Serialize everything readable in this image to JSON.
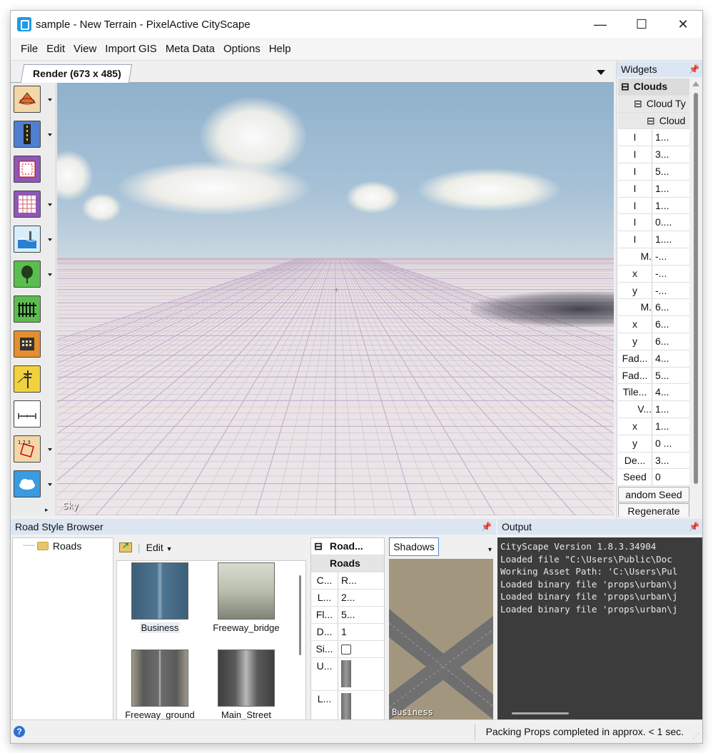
{
  "window": {
    "title": "sample - New Terrain - PixelActive CityScape",
    "minimize": "—",
    "maximize": "☐",
    "close": "✕"
  },
  "menu": [
    "File",
    "Edit",
    "View",
    "Import GIS",
    "Meta Data",
    "Options",
    "Help"
  ],
  "render_tab": {
    "label": "Render (673 x 485)"
  },
  "render": {
    "overlay_label": "Sky"
  },
  "toolbar_tools": [
    {
      "name": "terrain-tool-icon",
      "has_dropdown": true
    },
    {
      "name": "road-tool-icon",
      "has_dropdown": true
    },
    {
      "name": "lot-tool-icon",
      "has_dropdown": false
    },
    {
      "name": "grid-tool-icon",
      "has_dropdown": true
    },
    {
      "name": "water-tool-icon",
      "has_dropdown": true
    },
    {
      "name": "tree-tool-icon",
      "has_dropdown": true
    },
    {
      "name": "fence-tool-icon",
      "has_dropdown": false
    },
    {
      "name": "building-tool-icon",
      "has_dropdown": false
    },
    {
      "name": "powerline-tool-icon",
      "has_dropdown": false
    },
    {
      "name": "measure-tool-icon",
      "has_dropdown": false
    },
    {
      "name": "path-tool-icon",
      "has_dropdown": true
    },
    {
      "name": "sky-tool-icon",
      "has_dropdown": true
    }
  ],
  "widgets": {
    "title": "Widgets",
    "rows": [
      {
        "name": "Clouds",
        "value": "",
        "type": "section"
      },
      {
        "name": "Cloud Ty",
        "value": "",
        "type": "subsection"
      },
      {
        "name": "Cloud",
        "value": "",
        "type": "subsection"
      },
      {
        "name": "I",
        "value": "1..."
      },
      {
        "name": "I",
        "value": "3..."
      },
      {
        "name": "I",
        "value": "5..."
      },
      {
        "name": "I",
        "value": "1..."
      },
      {
        "name": "I",
        "value": "1..."
      },
      {
        "name": "I",
        "value": "0...."
      },
      {
        "name": "I",
        "value": "1...."
      },
      {
        "name": "M.",
        "value": "-..."
      },
      {
        "name": "x",
        "value": "-..."
      },
      {
        "name": "y",
        "value": "-..."
      },
      {
        "name": "M.",
        "value": "6..."
      },
      {
        "name": "x",
        "value": "6..."
      },
      {
        "name": "y",
        "value": "6..."
      },
      {
        "name": "Fad...",
        "value": "4..."
      },
      {
        "name": "Fad...",
        "value": "5..."
      },
      {
        "name": "Tile...",
        "value": "4..."
      },
      {
        "name": "V...",
        "value": "1..."
      },
      {
        "name": "x",
        "value": "1..."
      },
      {
        "name": "y",
        "value": "0 ..."
      },
      {
        "name": "De...",
        "value": "3..."
      },
      {
        "name": "Seed",
        "value": "0"
      }
    ],
    "random_seed_button": "andom Seed",
    "regenerate_button": "Regenerate"
  },
  "road_style_browser": {
    "title": "Road Style Browser",
    "tree_root": "Roads",
    "edit_menu": "Edit",
    "thumbnails": [
      {
        "label": "Business"
      },
      {
        "label": "Freeway_bridge"
      },
      {
        "label": "Freeway_ground"
      },
      {
        "label": "Main_Street"
      }
    ]
  },
  "road_props": {
    "header": "Road...",
    "section": "Roads",
    "rows": [
      {
        "name": "C...",
        "value": "R..."
      },
      {
        "name": "L...",
        "value": "2..."
      },
      {
        "name": "Fl...",
        "value": "5..."
      },
      {
        "name": "D...",
        "value": "1"
      },
      {
        "name": "Si...",
        "value": ""
      },
      {
        "name": "U...",
        "value": ""
      },
      {
        "name": "L...",
        "value": ""
      }
    ]
  },
  "preview": {
    "shadows_button": "Shadows",
    "label": "Business"
  },
  "output": {
    "title": "Output",
    "lines": [
      "CityScape Version 1.8.3.34904",
      "Loaded file \"C:\\Users\\Public\\Doc",
      "Working Asset Path: 'C:\\Users\\Pul",
      "Loaded binary file 'props\\urban\\j",
      "Loaded binary file 'props\\urban\\j",
      "Loaded binary file 'props\\urban\\j"
    ]
  },
  "status": {
    "message": "Packing Props completed in approx. < 1 sec."
  }
}
